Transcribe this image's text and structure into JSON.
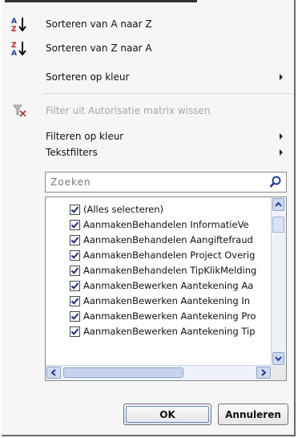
{
  "menu": {
    "sort_az": {
      "label": "Sorteren van A naar Z",
      "icon": "sort-ascending-icon"
    },
    "sort_za": {
      "label": "Sorteren van Z naar A",
      "icon": "sort-descending-icon"
    },
    "sort_color": {
      "label": "Sorteren op kleur"
    },
    "clear_filter": {
      "label": "Filter uit Autorisatie matrix wissen",
      "icon": "clear-filter-icon"
    },
    "filter_color": {
      "label": "Filteren op kleur"
    },
    "text_filters": {
      "label": "Tekstfilters"
    }
  },
  "search": {
    "placeholder": "Zoeken",
    "icon": "search-icon"
  },
  "list": {
    "items": [
      {
        "label": "(Alles selecteren)",
        "checked": true
      },
      {
        "label": "AanmakenBehandelen InformatieVe",
        "checked": true
      },
      {
        "label": "AanmakenBehandelen Aangiftefraud",
        "checked": true
      },
      {
        "label": "AanmakenBehandelen Project Overig",
        "checked": true
      },
      {
        "label": "AanmakenBehandelen TipKlikMelding",
        "checked": true
      },
      {
        "label": "AanmakenBewerken Aantekening Aa",
        "checked": true
      },
      {
        "label": "AanmakenBewerken Aantekening In",
        "checked": true
      },
      {
        "label": "AanmakenBewerken Aantekening Pro",
        "checked": true
      },
      {
        "label": "AanmakenBewerken Aantekening Tip",
        "checked": true
      }
    ]
  },
  "buttons": {
    "ok": "OK",
    "cancel": "Annuleren"
  },
  "colors": {
    "panel_bg": "#f6f6f6",
    "scroll_blue": "#cfdaf0",
    "disabled_text": "#a6a6a6"
  }
}
